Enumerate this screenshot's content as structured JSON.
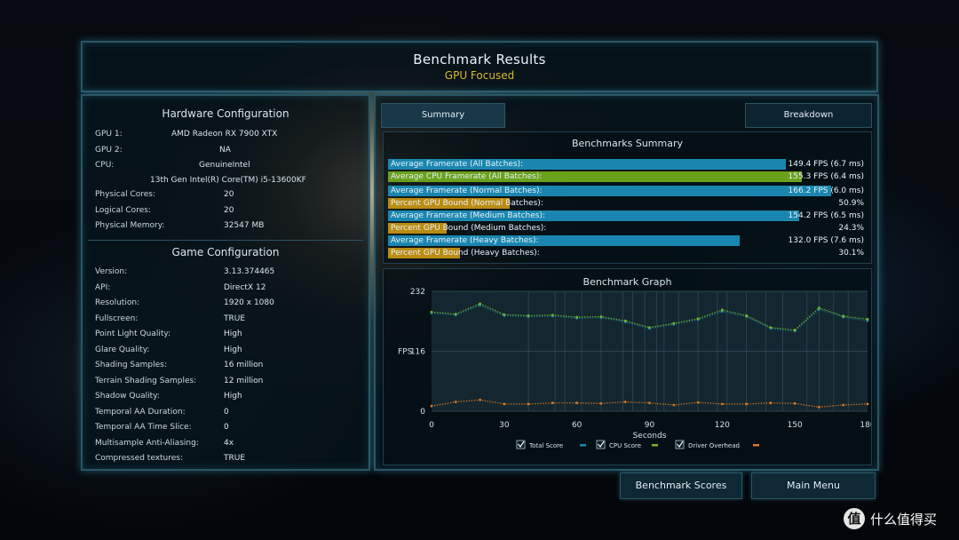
{
  "header": {
    "title": "Benchmark Results",
    "subtitle": "GPU Focused"
  },
  "hardware": {
    "heading": "Hardware Configuration",
    "rows": [
      {
        "label": "GPU 1:",
        "value": "AMD Radeon RX 7900 XTX"
      },
      {
        "label": "GPU 2:",
        "value": "NA"
      },
      {
        "label": "CPU:",
        "value": "GenuineIntel"
      },
      {
        "label": "",
        "value": "13th Gen Intel(R) Core(TM) i5-13600KF"
      },
      {
        "label": "Physical Cores:",
        "value": "20"
      },
      {
        "label": "Logical Cores:",
        "value": "20"
      },
      {
        "label": "Physical Memory:",
        "value": "32547  MB"
      }
    ]
  },
  "game": {
    "heading": "Game Configuration",
    "rows": [
      {
        "label": "Version:",
        "value": "3.13.374465"
      },
      {
        "label": "API:",
        "value": "DirectX 12"
      },
      {
        "label": "Resolution:",
        "value": "1920 x 1080"
      },
      {
        "label": "Fullscreen:",
        "value": "TRUE"
      },
      {
        "label": "Point Light Quality:",
        "value": "High"
      },
      {
        "label": "Glare Quality:",
        "value": "High"
      },
      {
        "label": "Shading Samples:",
        "value": "16 million"
      },
      {
        "label": "Terrain Shading Samples:",
        "value": "12 million"
      },
      {
        "label": "Shadow Quality:",
        "value": "High"
      },
      {
        "label": "Temporal AA Duration:",
        "value": "0"
      },
      {
        "label": "Temporal AA Time Slice:",
        "value": "0"
      },
      {
        "label": "Multisample Anti-Aliasing:",
        "value": "4x"
      },
      {
        "label": "Compressed textures:",
        "value": "TRUE"
      }
    ]
  },
  "tabs": {
    "summary": "Summary",
    "breakdown": "Breakdown"
  },
  "summary": {
    "heading": "Benchmarks Summary",
    "max_fps": 180,
    "rows": [
      {
        "label": "Average Framerate (All Batches):",
        "value": "149.4 FPS (6.7 ms)",
        "fps": 149.4,
        "color": "#1a86b0"
      },
      {
        "label": "Average CPU Framerate (All Batches):",
        "value": "155.3 FPS (6.4 ms)",
        "fps": 155.3,
        "color": "#6aa11c"
      },
      {
        "label": "Average Framerate (Normal Batches):",
        "value": "166.2 FPS (6.0 ms)",
        "fps": 166.2,
        "color": "#1a86b0"
      },
      {
        "label": "Percent GPU Bound (Normal Batches):",
        "value": "50.9%",
        "percent": 50.9,
        "color": "#b98c12"
      },
      {
        "label": "Average Framerate (Medium Batches):",
        "value": "154.2 FPS (6.5 ms)",
        "fps": 154.2,
        "color": "#1a86b0"
      },
      {
        "label": "Percent GPU Bound (Medium Batches):",
        "value": "24.3%",
        "percent": 24.3,
        "color": "#b98c12"
      },
      {
        "label": "Average Framerate (Heavy Batches):",
        "value": "132.0 FPS (7.6 ms)",
        "fps": 132.0,
        "color": "#1a86b0"
      },
      {
        "label": "Percent GPU Bound (Heavy Batches):",
        "value": "30.1%",
        "percent": 30.1,
        "color": "#b98c12"
      }
    ]
  },
  "graph": {
    "heading": "Benchmark Graph"
  },
  "chart_data": {
    "type": "scatter",
    "title": "Benchmark Graph",
    "xlabel": "Seconds",
    "ylabel": "FPS",
    "xlim": [
      0,
      180
    ],
    "ylim": [
      0,
      232
    ],
    "xticks": [
      "0",
      "30",
      "60",
      "90",
      "120",
      "150",
      "180"
    ],
    "yticks": [
      "0",
      "116",
      "232"
    ],
    "x_vertical_markers": [
      40,
      51,
      55,
      62,
      70,
      79,
      83,
      88,
      93,
      96,
      102,
      110,
      118,
      122,
      130,
      138,
      145,
      155,
      160,
      166,
      172
    ],
    "series": [
      {
        "name": "Total Score",
        "color": "#1a86b0",
        "x": [
          0,
          10,
          20,
          30,
          40,
          50,
          60,
          70,
          80,
          90,
          100,
          110,
          120,
          130,
          140,
          150,
          160,
          170,
          180
        ],
        "y": [
          190,
          186,
          205,
          185,
          183,
          184,
          180,
          181,
          173,
          160,
          168,
          177,
          193,
          183,
          160,
          155,
          197,
          182,
          175
        ]
      },
      {
        "name": "CPU Score",
        "color": "#76b82a",
        "x": [
          0,
          10,
          20,
          30,
          40,
          50,
          60,
          70,
          80,
          90,
          100,
          110,
          120,
          130,
          140,
          150,
          160,
          170,
          180
        ],
        "y": [
          192,
          188,
          208,
          187,
          185,
          186,
          182,
          183,
          175,
          162,
          170,
          179,
          196,
          185,
          162,
          157,
          200,
          184,
          178
        ]
      },
      {
        "name": "Driver Overhead",
        "color": "#e07820",
        "x": [
          0,
          10,
          20,
          30,
          40,
          50,
          60,
          70,
          80,
          90,
          100,
          110,
          120,
          130,
          140,
          150,
          160,
          170,
          180
        ],
        "y": [
          10,
          18,
          22,
          14,
          14,
          16,
          16,
          15,
          18,
          16,
          12,
          17,
          14,
          14,
          16,
          15,
          8,
          12,
          14
        ]
      }
    ],
    "legend": [
      "Total Score",
      "CPU Score",
      "Driver Overhead"
    ],
    "legend_position": "bottom",
    "grid": true
  },
  "buttons": {
    "benchmark_scores": "Benchmark Scores",
    "main_menu": "Main Menu"
  },
  "brand": {
    "text": "什么值得买",
    "icon": "值",
    "icon_name": "smzdm-logo-icon"
  },
  "colors": {
    "panel_border": "#2b5564",
    "accent": "#d9b832"
  }
}
